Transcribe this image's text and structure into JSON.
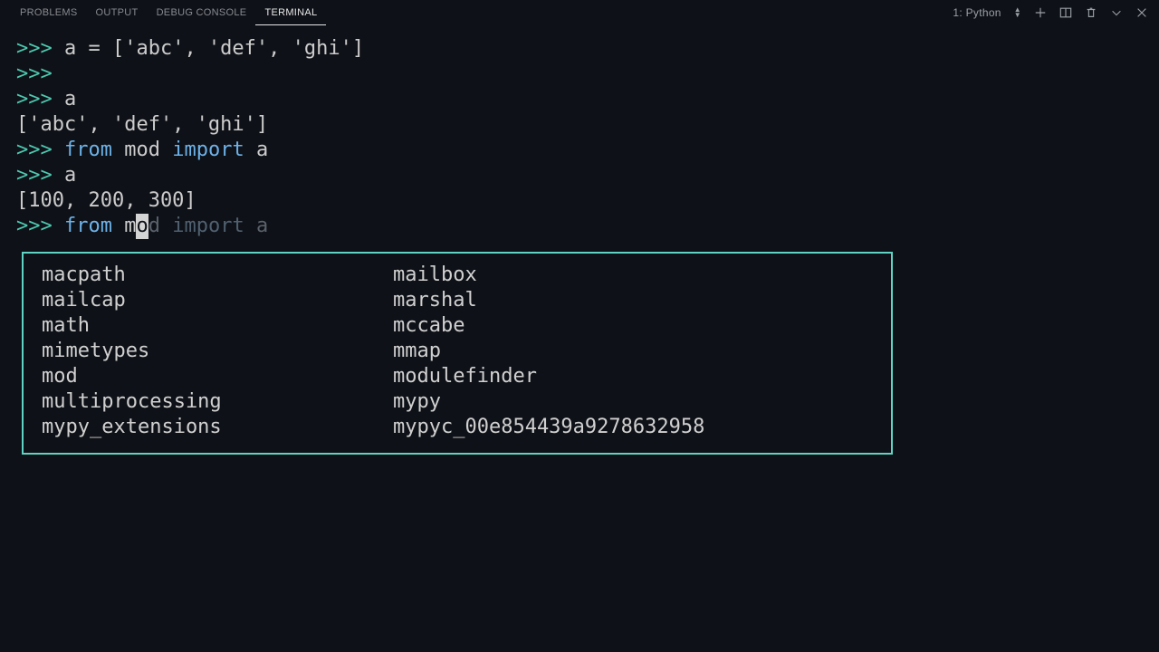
{
  "panel": {
    "tabs": {
      "problems": "PROBLEMS",
      "output": "OUTPUT",
      "debug_console": "DEBUG CONSOLE",
      "terminal": "TERMINAL"
    },
    "terminal_selector": "1: Python"
  },
  "repl": {
    "prompt": ">>>",
    "line1_code": " a = ['abc', 'def', 'ghi']",
    "line4_echo": "a",
    "line5_output": "['abc', 'def', 'ghi']",
    "import_from": "from",
    "import_module": "mod",
    "import_kw": "import",
    "import_name": "a",
    "line8_echo": "a",
    "line9_output": "[100, 200, 300]",
    "partial_from": "from",
    "partial_typed_prefix": "m",
    "partial_cursor_char": "o",
    "partial_ghost_mid": "d",
    "partial_ghost_import": "import",
    "partial_ghost_name": "a"
  },
  "completion": {
    "col1": [
      "macpath",
      "mailcap",
      "math",
      "mimetypes",
      "mod",
      "multiprocessing",
      "mypy_extensions"
    ],
    "col2": [
      "mailbox",
      "marshal",
      "mccabe",
      "mmap",
      "modulefinder",
      "mypy",
      "mypyc_00e854439a9278632958"
    ]
  }
}
